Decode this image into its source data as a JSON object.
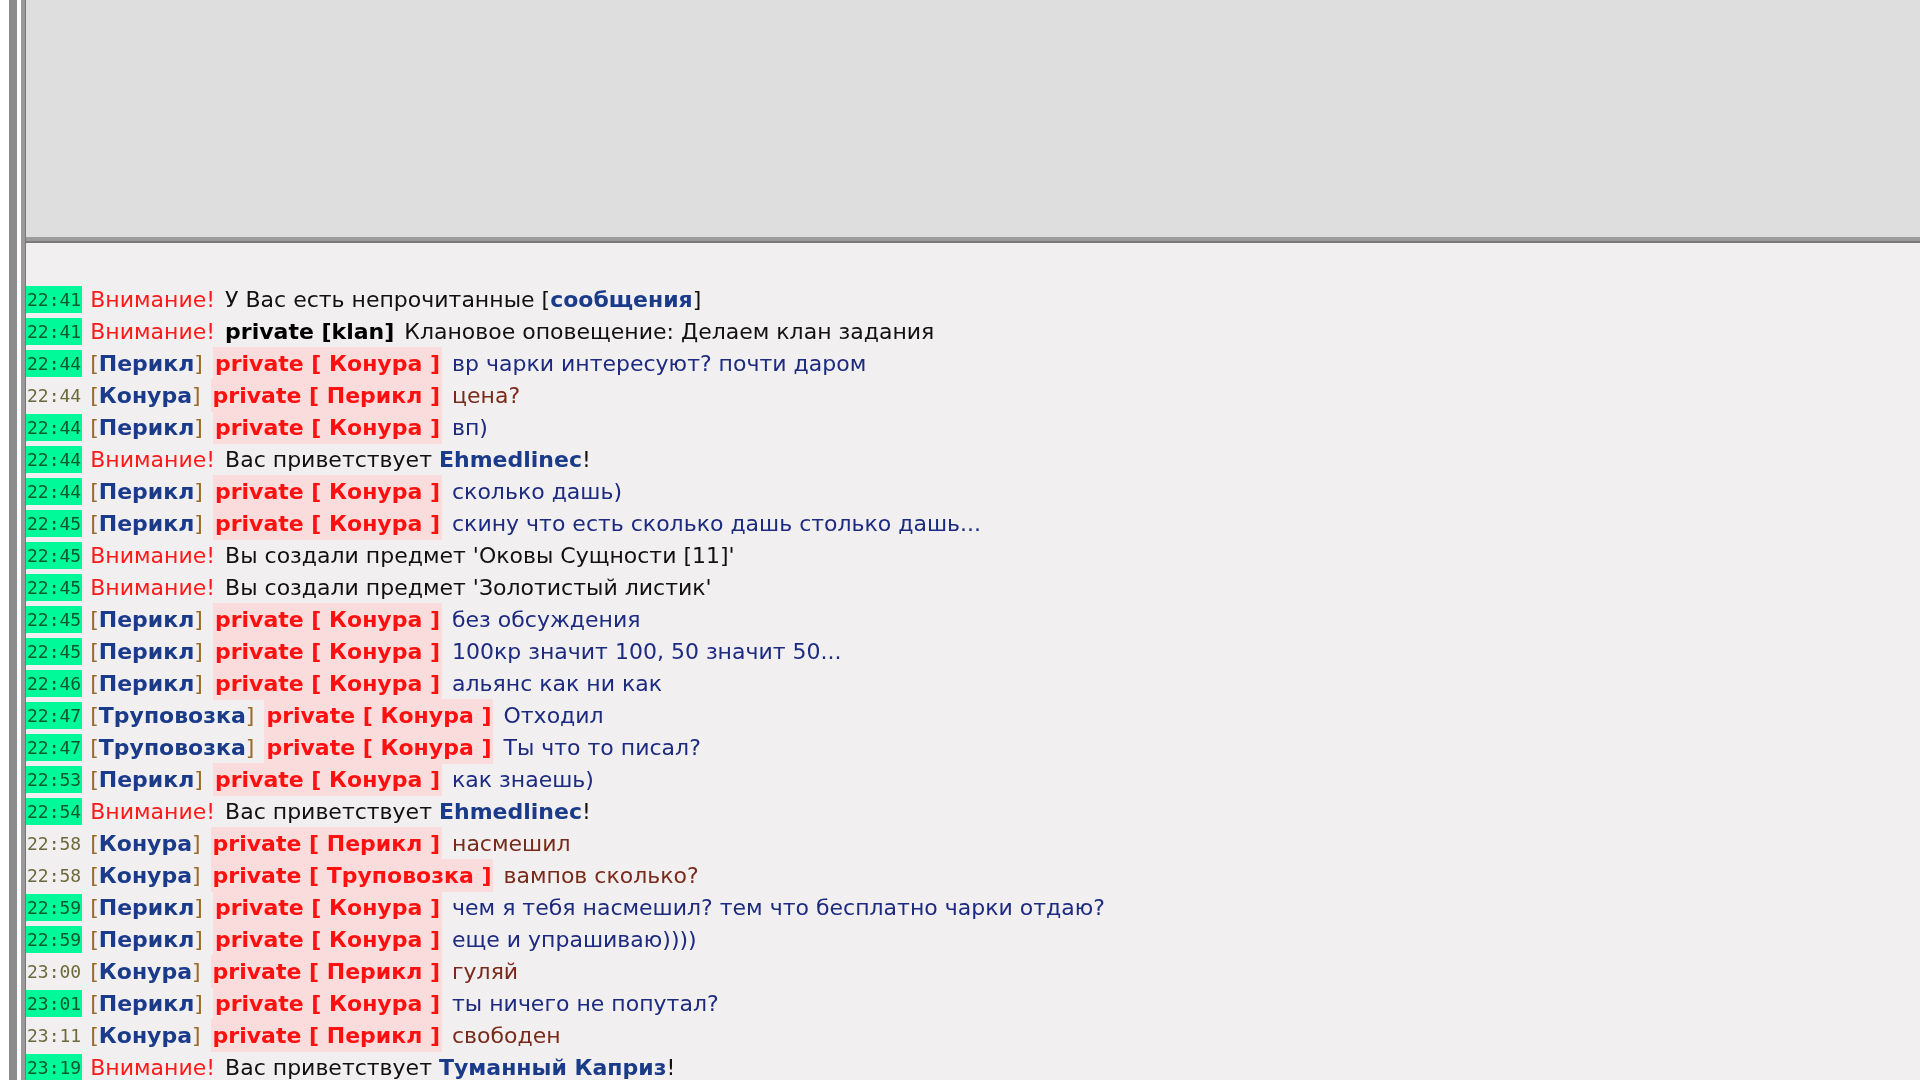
{
  "messages": [
    {
      "kind": "system",
      "time": "22:41",
      "highlighted": true,
      "label": "Внимание!",
      "text": "У Вас есть непрочитанные [**сообщения**]"
    },
    {
      "kind": "system",
      "time": "22:41",
      "highlighted": true,
      "label": "Внимание!",
      "tag": "private [klan]",
      "text": "Клановое оповещение: Делаем клан задания"
    },
    {
      "kind": "private",
      "time": "22:44",
      "highlighted": true,
      "outgoing": false,
      "sender": "[**Перикл**]",
      "recipient": "private [ Конура ]",
      "text": "вр чарки интересуют? почти даром"
    },
    {
      "kind": "private",
      "time": "22:44",
      "highlighted": false,
      "outgoing": true,
      "sender": "[**Конура**]",
      "recipient": "private [ Перикл ]",
      "text": "цена?"
    },
    {
      "kind": "private",
      "time": "22:44",
      "highlighted": true,
      "outgoing": false,
      "sender": "[**Перикл**]",
      "recipient": "private [ Конура ]",
      "text": "вп)"
    },
    {
      "kind": "system",
      "time": "22:44",
      "highlighted": true,
      "label": "Внимание!",
      "text": "Вас приветствует **Ehmedlinec**!"
    },
    {
      "kind": "private",
      "time": "22:44",
      "highlighted": true,
      "outgoing": false,
      "sender": "[**Перикл**]",
      "recipient": "private [ Конура ]",
      "text": "сколько дашь)"
    },
    {
      "kind": "private",
      "time": "22:45",
      "highlighted": true,
      "outgoing": false,
      "sender": "[**Перикл**]",
      "recipient": "private [ Конура ]",
      "text": "скину что есть сколько дашь столько дашь..."
    },
    {
      "kind": "system",
      "time": "22:45",
      "highlighted": true,
      "label": "Внимание!",
      "text": "Вы создали предмет 'Оковы Сущности [11]'"
    },
    {
      "kind": "system",
      "time": "22:45",
      "highlighted": true,
      "label": "Внимание!",
      "text": "Вы создали предмет 'Золотистый листик'"
    },
    {
      "kind": "private",
      "time": "22:45",
      "highlighted": true,
      "outgoing": false,
      "sender": "[**Перикл**]",
      "recipient": "private [ Конура ]",
      "text": "без обсуждения"
    },
    {
      "kind": "private",
      "time": "22:45",
      "highlighted": true,
      "outgoing": false,
      "sender": "[**Перикл**]",
      "recipient": "private [ Конура ]",
      "text": "100кр значит 100, 50 значит 50..."
    },
    {
      "kind": "private",
      "time": "22:46",
      "highlighted": true,
      "outgoing": false,
      "sender": "[**Перикл**]",
      "recipient": "private [ Конура ]",
      "text": "альянс как ни как"
    },
    {
      "kind": "private",
      "time": "22:47",
      "highlighted": true,
      "outgoing": false,
      "sender": "[**Труповозка**]",
      "recipient": "private [ Конура ]",
      "text": "Отходил"
    },
    {
      "kind": "private",
      "time": "22:47",
      "highlighted": true,
      "outgoing": false,
      "sender": "[**Труповозка**]",
      "recipient": "private [ Конура ]",
      "text": "Ты что то писал?"
    },
    {
      "kind": "private",
      "time": "22:53",
      "highlighted": true,
      "outgoing": false,
      "sender": "[**Перикл**]",
      "recipient": "private [ Конура ]",
      "text": "как знаешь)"
    },
    {
      "kind": "system",
      "time": "22:54",
      "highlighted": true,
      "label": "Внимание!",
      "text": "Вас приветствует **Ehmedlinec**!"
    },
    {
      "kind": "private",
      "time": "22:58",
      "highlighted": false,
      "outgoing": true,
      "sender": "[**Конура**]",
      "recipient": "private [ Перикл ]",
      "text": "насмешил"
    },
    {
      "kind": "private",
      "time": "22:58",
      "highlighted": false,
      "outgoing": true,
      "sender": "[**Конура**]",
      "recipient": "private [ Труповозка ]",
      "text": "вампов сколько?"
    },
    {
      "kind": "private",
      "time": "22:59",
      "highlighted": true,
      "outgoing": false,
      "sender": "[**Перикл**]",
      "recipient": "private [ Конура ]",
      "text": "чем я тебя насмешил? тем что бесплатно чарки отдаю?"
    },
    {
      "kind": "private",
      "time": "22:59",
      "highlighted": true,
      "outgoing": false,
      "sender": "[**Перикл**]",
      "recipient": "private [ Конура ]",
      "text": "еще и упрашиваю))))"
    },
    {
      "kind": "private",
      "time": "23:00",
      "highlighted": false,
      "outgoing": true,
      "sender": "[**Конура**]",
      "recipient": "private [ Перикл ]",
      "text": "гуляй"
    },
    {
      "kind": "private",
      "time": "23:01",
      "highlighted": true,
      "outgoing": false,
      "sender": "[**Перикл**]",
      "recipient": "private [ Конура ]",
      "text": "ты ничего не попутал?"
    },
    {
      "kind": "private",
      "time": "23:11",
      "highlighted": false,
      "outgoing": true,
      "sender": "[**Конура**]",
      "recipient": "private [ Перикл ]",
      "text": "свободен"
    },
    {
      "kind": "system",
      "time": "23:19",
      "highlighted": true,
      "label": "Внимание!",
      "text": "Вас приветствует **Туманный Каприз**!"
    }
  ]
}
